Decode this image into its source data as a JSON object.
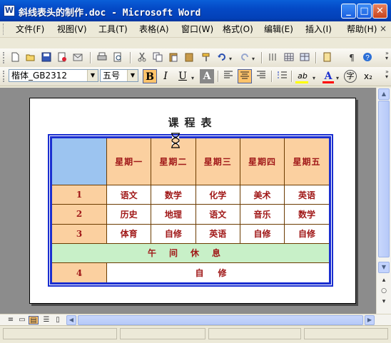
{
  "window": {
    "app_icon": "word-doc-icon",
    "title": "斜线表头的制作.doc - Microsoft Word",
    "minimize_glyph": "_",
    "maximize_glyph": "□",
    "close_glyph": "✕"
  },
  "menu": {
    "items": [
      "文件(F)",
      "视图(V)",
      "工具(T)",
      "表格(A)",
      "窗口(W)",
      "格式(O)",
      "编辑(E)",
      "插入(I)",
      "帮助(H)"
    ],
    "close_glyph": "×"
  },
  "standard_toolbar": {
    "icons": [
      "new-doc-icon",
      "open-folder-icon",
      "save-icon",
      "permission-icon",
      "email-icon",
      "print-icon",
      "print-preview-icon",
      "cut-icon",
      "copy-icon",
      "paste-icon",
      "paste-special-icon",
      "format-painter-icon",
      "undo-icon",
      "redo-icon",
      "columns-icon",
      "table-icon",
      "insert-table-icon",
      "research-icon",
      "show-formatting-icon",
      "help-icon"
    ]
  },
  "format_toolbar": {
    "font_name": "楷体_GB2312",
    "font_size": "五号",
    "bold": "B",
    "italic": "I",
    "underline": "U",
    "char_shading": "A",
    "highlight": "ab",
    "font_color": "A",
    "enclose_char": "字",
    "subscript": "x₂",
    "bold_active": true,
    "align_center_active": true,
    "highlight_color": "#ffff00",
    "font_color_value": "#ff0000"
  },
  "document": {
    "title": "课程表",
    "table": {
      "corner": "",
      "days": [
        "星期一",
        "星期二",
        "星期三",
        "星期四",
        "星期五"
      ],
      "rows": [
        {
          "num": "1",
          "subjects": [
            "语文",
            "数学",
            "化学",
            "美术",
            "英语"
          ]
        },
        {
          "num": "2",
          "subjects": [
            "历史",
            "地理",
            "语文",
            "音乐",
            "数学"
          ]
        },
        {
          "num": "3",
          "subjects": [
            "体育",
            "自修",
            "英语",
            "自修",
            "自修"
          ]
        }
      ],
      "lunch": "午间休息",
      "row4": {
        "num": "4",
        "merged": "自修"
      }
    },
    "colors": {
      "border": "#1a2ed0",
      "header_bg": "#fbd0a0",
      "corner_bg": "#9cc4f0",
      "lunch_bg": "#c8f0c8",
      "cell_text": "#a01818",
      "header_text": "#1c24d8"
    }
  },
  "view_buttons": [
    "normal-view-icon",
    "web-layout-icon",
    "print-layout-icon",
    "outline-icon",
    "reading-layout-icon"
  ]
}
